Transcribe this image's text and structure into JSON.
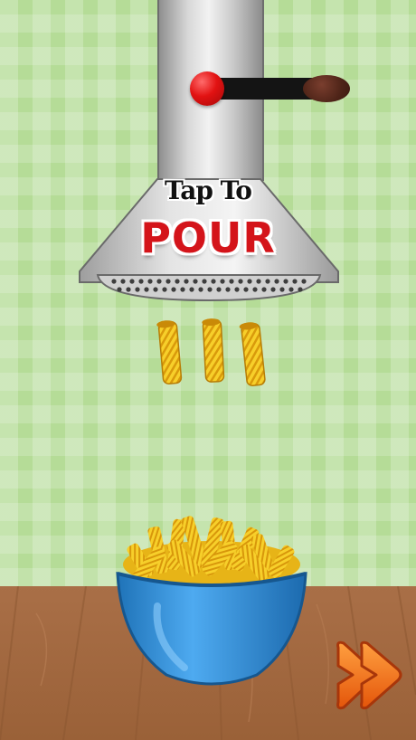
{
  "hood": {
    "tap_text": "Tap To",
    "pour_text": "POUR"
  },
  "colors": {
    "wall": "#b5dc97",
    "floor": "#a96f47",
    "pour_text": "#d4141a",
    "bowl": "#2f8fd8",
    "pasta": "#f3c21b",
    "next_button": "#f26a12"
  },
  "icons": {
    "next_button": "double-chevron-right-icon"
  }
}
